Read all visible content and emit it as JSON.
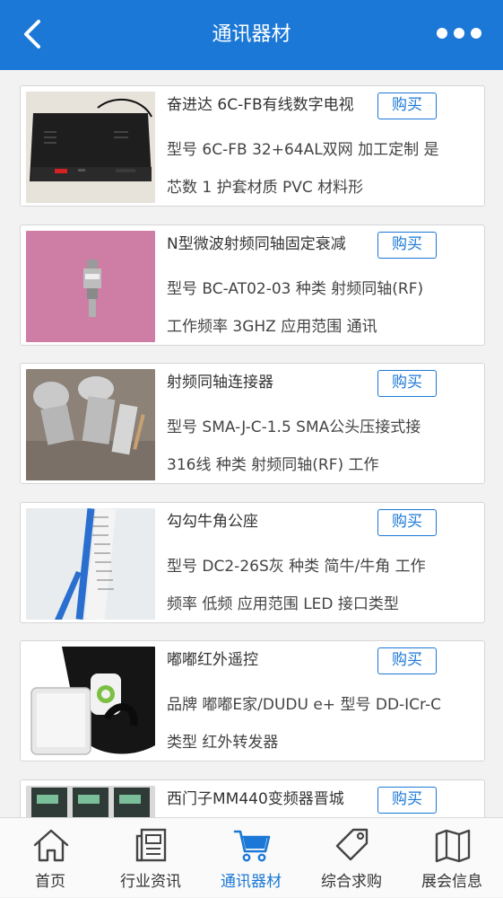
{
  "header": {
    "title": "通讯器材",
    "back_icon": "chevron-left-icon",
    "more_icon": "more-dots-icon"
  },
  "products": [
    {
      "title": "奋进达 6C-FB有线数字电视",
      "buy_label": "购买",
      "desc_line1": "型号 6C-FB 32+64AL双网 加工定制 是",
      "desc_line2": "芯数 1 护套材质 PVC 材料形"
    },
    {
      "title": "N型微波射频同轴固定衰减",
      "buy_label": "购买",
      "desc_line1": "型号 BC-AT02-03 种类 射频同轴(RF)",
      "desc_line2": "工作频率 3GHZ 应用范围 通讯"
    },
    {
      "title": "射频同轴连接器",
      "buy_label": "购买",
      "desc_line1": "型号 SMA-J-C-1.5 SMA公头压接式接",
      "desc_line2": "316线 种类 射频同轴(RF) 工作"
    },
    {
      "title": "勾勾牛角公座",
      "buy_label": "购买",
      "desc_line1": "型号 DC2-26S灰 种类 简牛/牛角 工作",
      "desc_line2": "频率 低频 应用范围 LED 接口类型"
    },
    {
      "title": "嘟嘟红外遥控",
      "buy_label": "购买",
      "desc_line1": "品牌 嘟嘟E家/DUDU e+ 型号 DD-ICr-C",
      "desc_line2": "类型 红外转发器"
    },
    {
      "title": "西门子MM440变频器晋城",
      "buy_label": "购买",
      "desc_line1": "",
      "desc_line2": ""
    }
  ],
  "tabbar": {
    "tabs": [
      {
        "label": "首页",
        "icon": "home-icon"
      },
      {
        "label": "行业资讯",
        "icon": "news-icon"
      },
      {
        "label": "通讯器材",
        "icon": "cart-icon"
      },
      {
        "label": "综合求购",
        "icon": "tag-icon"
      },
      {
        "label": "展会信息",
        "icon": "map-icon"
      }
    ],
    "active_index": 2
  },
  "colors": {
    "header_bg": "#1b78d6",
    "accent": "#1b78d6",
    "page_bg": "#f2f2f2"
  }
}
